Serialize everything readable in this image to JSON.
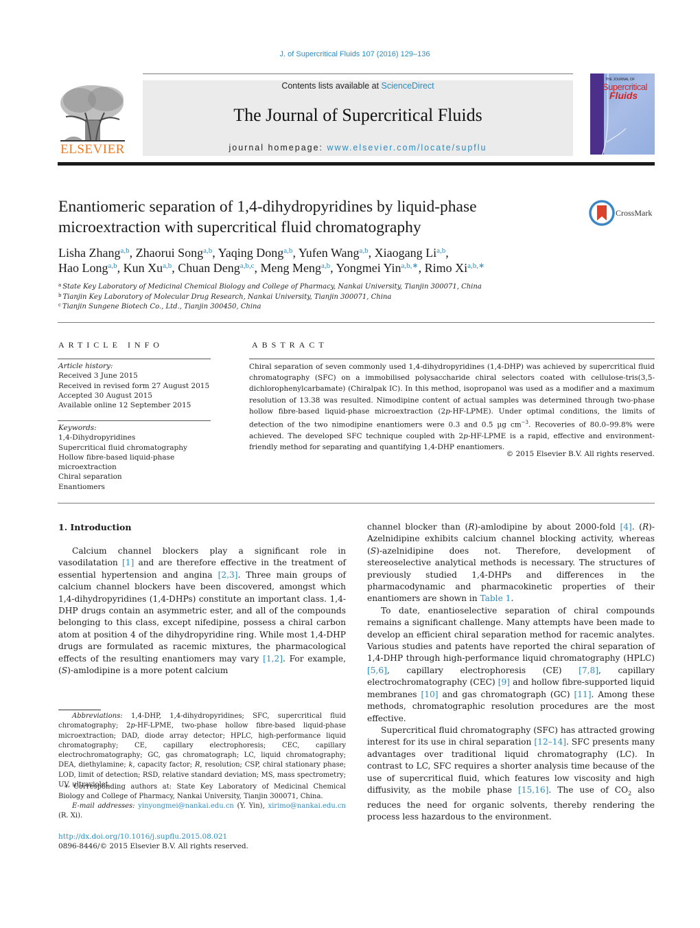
{
  "running_head": "J. of Supercritical Fluids 107 (2016) 129–136",
  "masthead": {
    "publisher_wordmark": "ELSEVIER",
    "contents_prefix": "Contents lists available at ",
    "contents_link": "ScienceDirect",
    "journal_title": "The Journal of Supercritical Fluids",
    "homepage_prefix": "journal homepage: ",
    "homepage_link": "www.elsevier.com/locate/supflu",
    "cover": {
      "small_text": "THE JOURNAL OF",
      "line1": "Supercritical",
      "line2": "Fluids"
    }
  },
  "article": {
    "title": "Enantiomeric separation of 1,4-dihydropyridines by liquid-phase microextraction with supercritical fluid chromatography",
    "crossmark_label": "CrossMark",
    "authors": [
      {
        "name": "Lisha Zhang",
        "aff": "a,b",
        "sep": ", "
      },
      {
        "name": "Zhaorui Song",
        "aff": "a,b",
        "sep": ", "
      },
      {
        "name": "Yaqing Dong",
        "aff": "a,b",
        "sep": ", "
      },
      {
        "name": "Yufen Wang",
        "aff": "a,b",
        "sep": ", "
      },
      {
        "name": "Xiaogang Li",
        "aff": "a,b",
        "sep": ","
      },
      {
        "name": "Hao Long",
        "aff": "a,b",
        "sep": ", "
      },
      {
        "name": "Kun Xu",
        "aff": "a,b",
        "sep": ", "
      },
      {
        "name": "Chuan Deng",
        "aff": "a,b,c",
        "sep": ", "
      },
      {
        "name": "Meng Meng",
        "aff": "a,b",
        "sep": ", "
      },
      {
        "name": "Yongmei Yin",
        "aff": "a,b,∗",
        "sep": ", "
      },
      {
        "name": "Rimo Xi",
        "aff": "a,b,∗",
        "sep": ""
      }
    ],
    "affiliations": [
      {
        "key": "a",
        "text": "State Key Laboratory of Medicinal Chemical Biology and College of Pharmacy, Nankai University, Tianjin 300071, China"
      },
      {
        "key": "b",
        "text": "Tianjin Key Laboratory of Molecular Drug Research, Nankai University, Tianjin 300071, China"
      },
      {
        "key": "c",
        "text": "Tianjin Sungene Biotech Co., Ltd., Tianjin 300450, China"
      }
    ]
  },
  "article_info": {
    "heading": "ARTICLE INFO",
    "history_label": "Article history:",
    "history": [
      "Received 3 June 2015",
      "Received in revised form 27 August 2015",
      "Accepted 30 August 2015",
      "Available online 12 September 2015"
    ],
    "keywords_label": "Keywords:",
    "keywords": [
      "1,4-Dihydropyridines",
      "Supercritical fluid chromatography",
      "Hollow fibre-based liquid-phase microextraction",
      "Chiral separation",
      "Enantiomers"
    ]
  },
  "abstract": {
    "heading": "ABSTRACT",
    "text_1": "Chiral separation of seven commonly used 1,4-dihydropyridines (1,4-DHP) was achieved by supercritical fluid chromatography (SFC) on a immobilised polysaccharide chiral selectors coated with cellulose-tris(3,5-dichlorophenylcarbamate) (Chiralpak IC). In this method, isopropanol was used as a modifier and a maximum resolution of 13.38 was resulted. Nimodipine content of actual samples was determined through two-phase hollow fibre-based liquid-phase microextraction (2",
    "text_1_italic": "p",
    "text_2": "-HF-LPME). Under optimal conditions, the limits of detection of the two nimodipine enantiomers were 0.3 and 0.5 µg cm",
    "text_2_sup": "−3",
    "text_3": ". Recoveries of 80.0–99.8% were achieved. The developed SFC technique coupled with 2",
    "text_3_italic": "p",
    "text_4": "-HF-LPME is a rapid, effective and environment-friendly method for separating and quantifying 1,4-DHP enantiomers.",
    "copyright": "© 2015 Elsevier B.V. All rights reserved."
  },
  "body": {
    "section_heading": "1.  Introduction",
    "left_paragraph": {
      "t1": "Calcium channel blockers play a significant role in vasodilatation ",
      "r1": "[1]",
      "t2": " and are therefore effective in the treatment of essential hypertension and angina ",
      "r2": "[2,3]",
      "t3": ". Three main groups of calcium channel blockers have been discovered, amongst which 1,4-dihydropyridines (1,4-DHPs) constitute an important class. 1,4-DHP drugs contain an asymmetric ester, and all of the compounds belonging to this class, except nifedipine, possess a chiral carbon atom at position 4 of the dihydropyridine ring. While most 1,4-DHP drugs are formulated as racemic mixtures, the pharmacological effects of the resulting enantiomers may vary ",
      "r3": "[1,2]",
      "t4": ". For example, (",
      "i1": "S",
      "t5": ")-amlodipine is a more potent calcium"
    },
    "right_paragraph_1": {
      "t1": "channel blocker than (",
      "i1": "R",
      "t2": ")-amlodipine by about 2000-fold ",
      "r1": "[4]",
      "t3": ". (",
      "i2": "R",
      "t4": ")-Azelnidipine exhibits calcium channel blocking activity, whereas (",
      "i3": "S",
      "t5": ")-azelnidipine does not. Therefore, development of stereoselective analytical methods is necessary. The structures of previously studied 1,4-DHPs and differences in the pharmacodynamic and pharmacokinetic properties of their enantiomers are shown in ",
      "r2": "Table 1",
      "t6": "."
    },
    "right_paragraph_2": {
      "t1": "To date, enantioselective separation of chiral compounds remains a significant challenge. Many attempts have been made to develop an efficient chiral separation method for racemic analytes. Various studies and patents have reported the chiral separation of 1,4-DHP through high-performance liquid chromatography (HPLC) ",
      "r1": "[5,6]",
      "t2": ", capillary electrophoresis (CE) ",
      "r2": "[7,8]",
      "t3": ", capillary electrochromatography (CEC) ",
      "r3": "[9]",
      "t4": " and hollow fibre-supported liquid membranes ",
      "r4": "[10]",
      "t5": " and gas chromatograph (GC) ",
      "r5": "[11]",
      "t6": ". Among these methods, chromatographic resolution procedures are the most effective."
    },
    "right_paragraph_3": {
      "t1": "Supercritical fluid chromatography (SFC) has attracted growing interest for its use in chiral separation ",
      "r1": "[12–14]",
      "t2": ". SFC presents many advantages over traditional liquid chromatography (LC). In contrast to LC, SFC requires a shorter analysis time because of the use of supercritical fluid, which features low viscosity and high diffusivity, as the mobile phase ",
      "r2": "[15,16]",
      "t3": ". The use of CO",
      "sub": "2",
      "t4": " also reduces the need for organic solvents, thereby rendering the process less hazardous to the environment."
    }
  },
  "footnotes": {
    "abbrev_label": "Abbreviations:",
    "abbrev_t1": "  1,4-DHP, 1,4-dihydropyridines; SFC, supercritical fluid chromatography; 2",
    "abbrev_i1": "p",
    "abbrev_t2": "-HF-LPME, two-phase hollow fibre-based liquid-phase microextraction; DAD, diode array detector; HPLC, high-performance liquid chromatography; CE, capillary electrophoresis; CEC, capillary electrochromatography; GC, gas chromatograph; LC, liquid chromatography; DEA, diethylamine; ",
    "abbrev_i2": "k",
    "abbrev_t3": ", capacity factor; ",
    "abbrev_i3": "R",
    "abbrev_t4": ", resolution; CSP, chiral stationary phase; LOD, limit of detection; RSD, relative standard deviation; MS, mass spectrometry; UV, ultraviolet.",
    "corresponding": "∗  Corresponding authors at: State Key Laboratory of Medicinal Chemical Biology and College of Pharmacy, Nankai University, Tianjin 300071, China.",
    "email_label": "E-mail addresses:",
    "email_1": "yinyongmei@nankai.edu.cn",
    "email_1_who": " (Y. Yin), ",
    "email_2": "xirimo@nankai.edu.cn",
    "email_2_who": " (R. Xi).",
    "doi": "http://dx.doi.org/10.1016/j.supflu.2015.08.021",
    "issn": "0896-8446/© 2015 Elsevier B.V. All rights reserved."
  },
  "colors": {
    "link": "#2a8bbf",
    "elsevier_orange": "#f07a20",
    "masthead_bg": "#ebebeb",
    "crossmark_red": "#d9432b",
    "crossmark_blue": "#3b87c6"
  }
}
